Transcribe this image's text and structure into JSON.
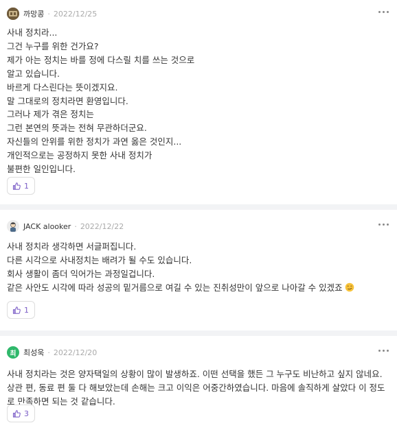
{
  "comments": [
    {
      "author": "까망콩",
      "date": "2022/12/25",
      "lines": [
        "사내 정치라...",
        "그건 누구를 위한 건가요?",
        "제가 아는 정치는 바를 정에 다스릴 치를 쓰는 것으로",
        "알고 있습니다.",
        "바르게 다스린다는 뜻이겠지요.",
        "말 그대로의 정치라면 환영입니다.",
        "그러나 제가 겪은 정치는",
        "그런 본연의 뜻과는 전혀 무관하더군요.",
        "자신들의 안위를 위한 정치가 과연 옳은 것인지...",
        "개인적으로는 공정하지 못한 사내 정치가",
        "불편한 일인입니다."
      ],
      "likes": "1"
    },
    {
      "author": "JACK alooker",
      "date": "2022/12/22",
      "lines": [
        "사내 정치라 생각하면 서글퍼집니다.",
        "다른 시각으로 사내정치는 배려가 될 수도 있습니다.",
        "회사 생활이 좀더 익어가는 과정일겁니다.",
        "같은 사안도 시각에 따라 성공의 밑거름으로 여길 수 있는 진취성만이 앞으로 나아갈 수 있겠죠"
      ],
      "likes": "1"
    },
    {
      "author": "최성욱",
      "avatar_text": "최",
      "date": "2022/12/20",
      "text": "사내 정치라는 것은 양자택일의 상황이 많이 발생하죠. 이떤 선택을 했든 그 누구도 비난하고 싶지 않네요. 상관 편, 동료 편 둘 다 해보았는데 손해는 크고 이익은 어중간하였습니다. 마음에 솔직하게 살았다 이 정도로 만족하면 되는 것 같습니다.",
      "likes": "3"
    }
  ],
  "separator": "·",
  "colors": {
    "accent": "#7a5cc6",
    "divider": "#f2f3f5",
    "meta": "#aaaaaa"
  },
  "icons": {
    "like": "thumbs-up-icon",
    "more": "more-dots-icon"
  }
}
